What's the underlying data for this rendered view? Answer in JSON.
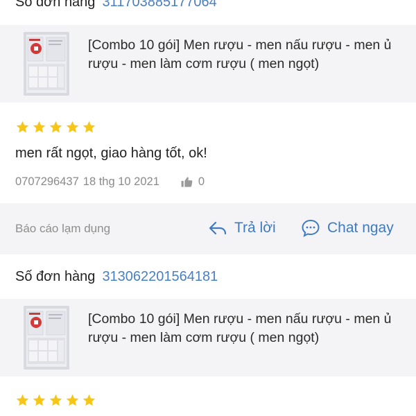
{
  "reviews": [
    {
      "order_label": "Số đơn hàng",
      "order_number": "311703885177064",
      "product_name": "[Combo 10 gói] Men rượu - men nấu rượu - men ủ rượu - men làm cơm rượu ( men ngọt)",
      "rating": 5,
      "comment": "men rất ngọt, giao hàng tốt, ok!",
      "reviewer": "0707296437",
      "date": "18 thg 10 2021",
      "likes": "0"
    },
    {
      "order_label": "Số đơn hàng",
      "order_number": "313062201564181",
      "product_name": "[Combo 10 gói] Men rượu - men nấu rượu - men ủ rượu - men làm cơm rượu ( men ngọt)",
      "rating": 5
    }
  ],
  "actions": {
    "report": "Báo cáo lạm dụng",
    "reply": "Trả lời",
    "chat": "Chat ngay"
  },
  "colors": {
    "link": "#4a7fc1",
    "star": "#f5c518",
    "card_bg": "#f4f4f6"
  },
  "icons": [
    "star-icon",
    "thumbs-up-icon",
    "reply-icon",
    "chat-bubble-icon"
  ]
}
